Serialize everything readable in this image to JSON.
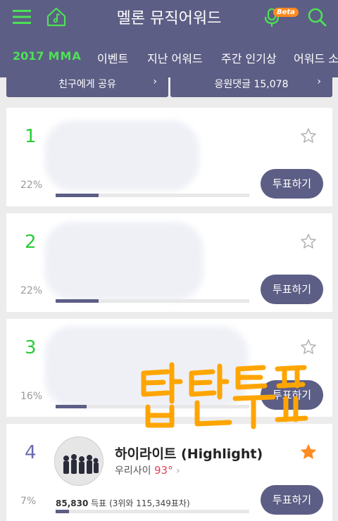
{
  "header": {
    "title": "멜론 뮤직어워드",
    "beta": "Beta",
    "colors": {
      "bar": "#5d5e85",
      "accent_green": "#2bcc3a",
      "orange": "#ff8a1f"
    }
  },
  "nav": {
    "logo_year": "2017",
    "logo_text": "MMA",
    "items": [
      "이벤트",
      "지난 어워드",
      "주간 인기상",
      "어워드 소"
    ]
  },
  "share": {
    "left_label": "친구에게 공유",
    "right_label": "응원댓글 15,078"
  },
  "cards": [
    {
      "rank": "1",
      "percent": "22%",
      "progress": 22,
      "vote_label": "투표하기",
      "favorited": false
    },
    {
      "rank": "2",
      "percent": "22%",
      "progress": 22,
      "vote_label": "투표하기",
      "favorited": false
    },
    {
      "rank": "3",
      "percent": "16%",
      "progress": 16,
      "vote_label": "투표하기",
      "favorited": false
    },
    {
      "rank": "4",
      "percent": "7%",
      "progress": 7,
      "vote_label": "투표하기",
      "favorited": true,
      "artist": "하이라이트 (Highlight)",
      "song": "우리사이",
      "temperature": "93°",
      "votes": "85,830",
      "votes_unit": "득표",
      "gap": "(3위와 115,349표차)"
    }
  ],
  "overlay": {
    "handwriting": "탑텐투표"
  }
}
